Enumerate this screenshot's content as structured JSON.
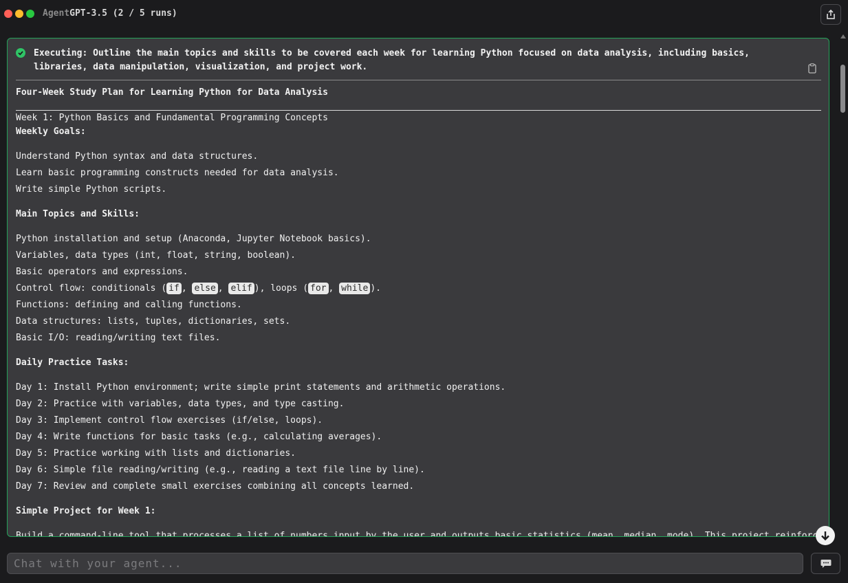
{
  "window": {
    "brand": "Agent",
    "title_rest": "GPT-3.5 (2 / 5 runs)"
  },
  "task": {
    "executing_text": "Executing: Outline the main topics and skills to be covered each week for learning Python focused on data analysis, including basics, libraries, data manipulation, visualization, and project work.",
    "heading": "Four-Week Study Plan for Learning Python for Data Analysis",
    "week_title": "Week 1: Python Basics and Fundamental Programming Concepts",
    "goals_heading": "Weekly Goals:",
    "goals": [
      "Understand Python syntax and data structures.",
      "Learn basic programming constructs needed for data analysis.",
      "Write simple Python scripts."
    ],
    "topics_heading": "Main Topics and Skills:",
    "topics": [
      "Python installation and setup (Anaconda, Jupyter Notebook basics).",
      "Variables, data types (int, float, string, boolean).",
      "Basic operators and expressions.",
      "",
      "Functions: defining and calling functions.",
      "Data structures: lists, tuples, dictionaries, sets.",
      "Basic I/O: reading/writing text files."
    ],
    "control_flow": {
      "prefix": "Control flow: conditionals (",
      "kw1": "if",
      "sep1": ", ",
      "kw2": "else",
      "sep2": ", ",
      "kw3": "elif",
      "mid": "), loops (",
      "kw4": "for",
      "sep3": ", ",
      "kw5": "while",
      "suffix": ")."
    },
    "daily_heading": "Daily Practice Tasks:",
    "daily": [
      "Day 1: Install Python environment; write simple print statements and arithmetic operations.",
      "Day 2: Practice with variables, data types, and type casting.",
      "Day 3: Implement control flow exercises (if/else, loops).",
      "Day 4: Write functions for basic tasks (e.g., calculating averages).",
      "Day 5: Practice working with lists and dictionaries.",
      "Day 6: Simple file reading/writing (e.g., reading a text file line by line).",
      "Day 7: Review and complete small exercises combining all concepts learned."
    ],
    "project_heading": "Simple Project for Week 1:",
    "project_text": "Build a command-line tool that processes a list of numbers input by the user and outputs basic statistics (mean, median, mode). This project reinforces"
  },
  "chat": {
    "placeholder": "Chat with your agent..."
  },
  "icons": {
    "share": "share-icon",
    "copy": "clipboard-icon",
    "check": "check-circle-icon",
    "scroll_down": "arrow-down-icon",
    "send": "chat-bubble-icon"
  },
  "colors": {
    "accent_green": "#25a35a",
    "panel_bg": "#3a3a3d",
    "page_bg": "#1b1b1d"
  }
}
